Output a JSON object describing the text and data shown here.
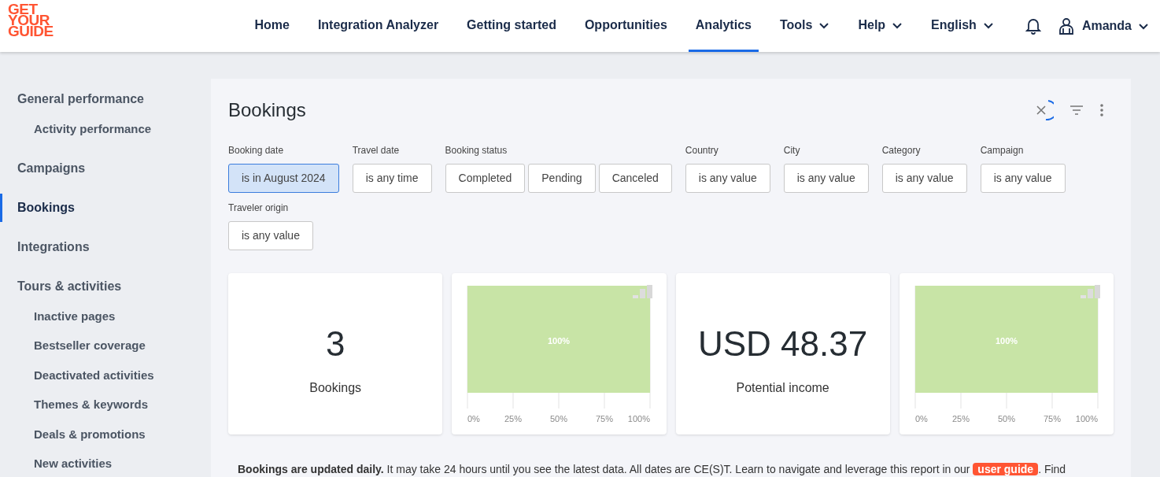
{
  "logo": {
    "lines": [
      "GET",
      "YOUR",
      "GUIDE"
    ]
  },
  "nav": [
    {
      "label": "Home",
      "selected": false,
      "dropdown": false
    },
    {
      "label": "Integration Analyzer",
      "selected": false,
      "dropdown": false
    },
    {
      "label": "Getting started",
      "selected": false,
      "dropdown": false
    },
    {
      "label": "Opportunities",
      "selected": false,
      "dropdown": false
    },
    {
      "label": "Analytics",
      "selected": true,
      "dropdown": false
    },
    {
      "label": "Tools",
      "selected": false,
      "dropdown": true
    },
    {
      "label": "Help",
      "selected": false,
      "dropdown": true
    },
    {
      "label": "English",
      "selected": false,
      "dropdown": true
    }
  ],
  "user": {
    "name": "Amanda"
  },
  "sidebar": {
    "items": [
      {
        "label": "General performance",
        "selected": false,
        "children": [
          {
            "label": "Activity performance",
            "selected": false
          }
        ]
      },
      {
        "label": "Campaigns",
        "selected": false
      },
      {
        "label": "Bookings",
        "selected": true
      },
      {
        "label": "Integrations",
        "selected": false
      },
      {
        "label": "Tours & activities",
        "selected": false,
        "children": [
          {
            "label": "Inactive pages",
            "selected": false
          },
          {
            "label": "Bestseller coverage",
            "selected": false
          },
          {
            "label": "Deactivated activities",
            "selected": false
          },
          {
            "label": "Themes & keywords",
            "selected": false
          },
          {
            "label": "Deals & promotions",
            "selected": false
          },
          {
            "label": "New activities",
            "selected": false
          }
        ]
      }
    ]
  },
  "title": "Bookings",
  "filters": [
    {
      "label": "Booking date",
      "chips": [
        {
          "text": "is in August 2024",
          "selected": true
        }
      ]
    },
    {
      "label": "Travel date",
      "chips": [
        {
          "text": "is any time",
          "selected": false
        }
      ]
    },
    {
      "label": "Booking status",
      "chips": [
        {
          "text": "Completed",
          "selected": false
        },
        {
          "text": "Pending",
          "selected": false
        },
        {
          "text": "Canceled",
          "selected": false
        }
      ]
    },
    {
      "label": "Country",
      "chips": [
        {
          "text": "is any value",
          "selected": false
        }
      ]
    },
    {
      "label": "City",
      "chips": [
        {
          "text": "is any value",
          "selected": false
        }
      ]
    },
    {
      "label": "Category",
      "chips": [
        {
          "text": "is any value",
          "selected": false
        }
      ]
    },
    {
      "label": "Campaign",
      "chips": [
        {
          "text": "is any value",
          "selected": false
        }
      ]
    },
    {
      "label": "Traveler origin",
      "chips": [
        {
          "text": "is any value",
          "selected": false
        }
      ]
    }
  ],
  "cards": [
    {
      "kind": "stat",
      "value": "3",
      "label": "Bookings"
    },
    {
      "kind": "chart",
      "chart_data": {
        "type": "bar",
        "orientation": "horizontal",
        "grid": true,
        "values": [
          100
        ],
        "xlim": [
          0,
          100
        ],
        "xticks": [
          {
            "value": 0,
            "label": "0%"
          },
          {
            "value": 25,
            "label": "25%"
          },
          {
            "value": 50,
            "label": "50%"
          },
          {
            "value": 75,
            "label": "75%"
          },
          {
            "value": 100,
            "label": "100%"
          }
        ],
        "value_labels": [
          "100%"
        ],
        "color": "#c8e4a6"
      }
    },
    {
      "kind": "stat",
      "value": "USD 48.37",
      "label": "Potential income"
    },
    {
      "kind": "chart",
      "chart_data": {
        "type": "bar",
        "orientation": "horizontal",
        "values": [
          100
        ],
        "xlim": [
          0,
          100
        ],
        "xticks": [
          {
            "value": 0,
            "label": "0%"
          },
          {
            "value": 25,
            "label": "25%"
          },
          {
            "value": 50,
            "label": "50%"
          },
          {
            "value": 75,
            "label": "75%"
          },
          {
            "value": 100,
            "label": "100%"
          }
        ],
        "value_labels": [
          "100%"
        ],
        "color": "#c8e4a6",
        "grid": true
      }
    }
  ],
  "note": {
    "before": "**Bookings are updated daily.** It may take 24 hours until you see the latest data. All dates are CE(S)T. Learn to navigate and leverage this report in our ",
    "link": "user guide",
    "after": ". Find"
  }
}
